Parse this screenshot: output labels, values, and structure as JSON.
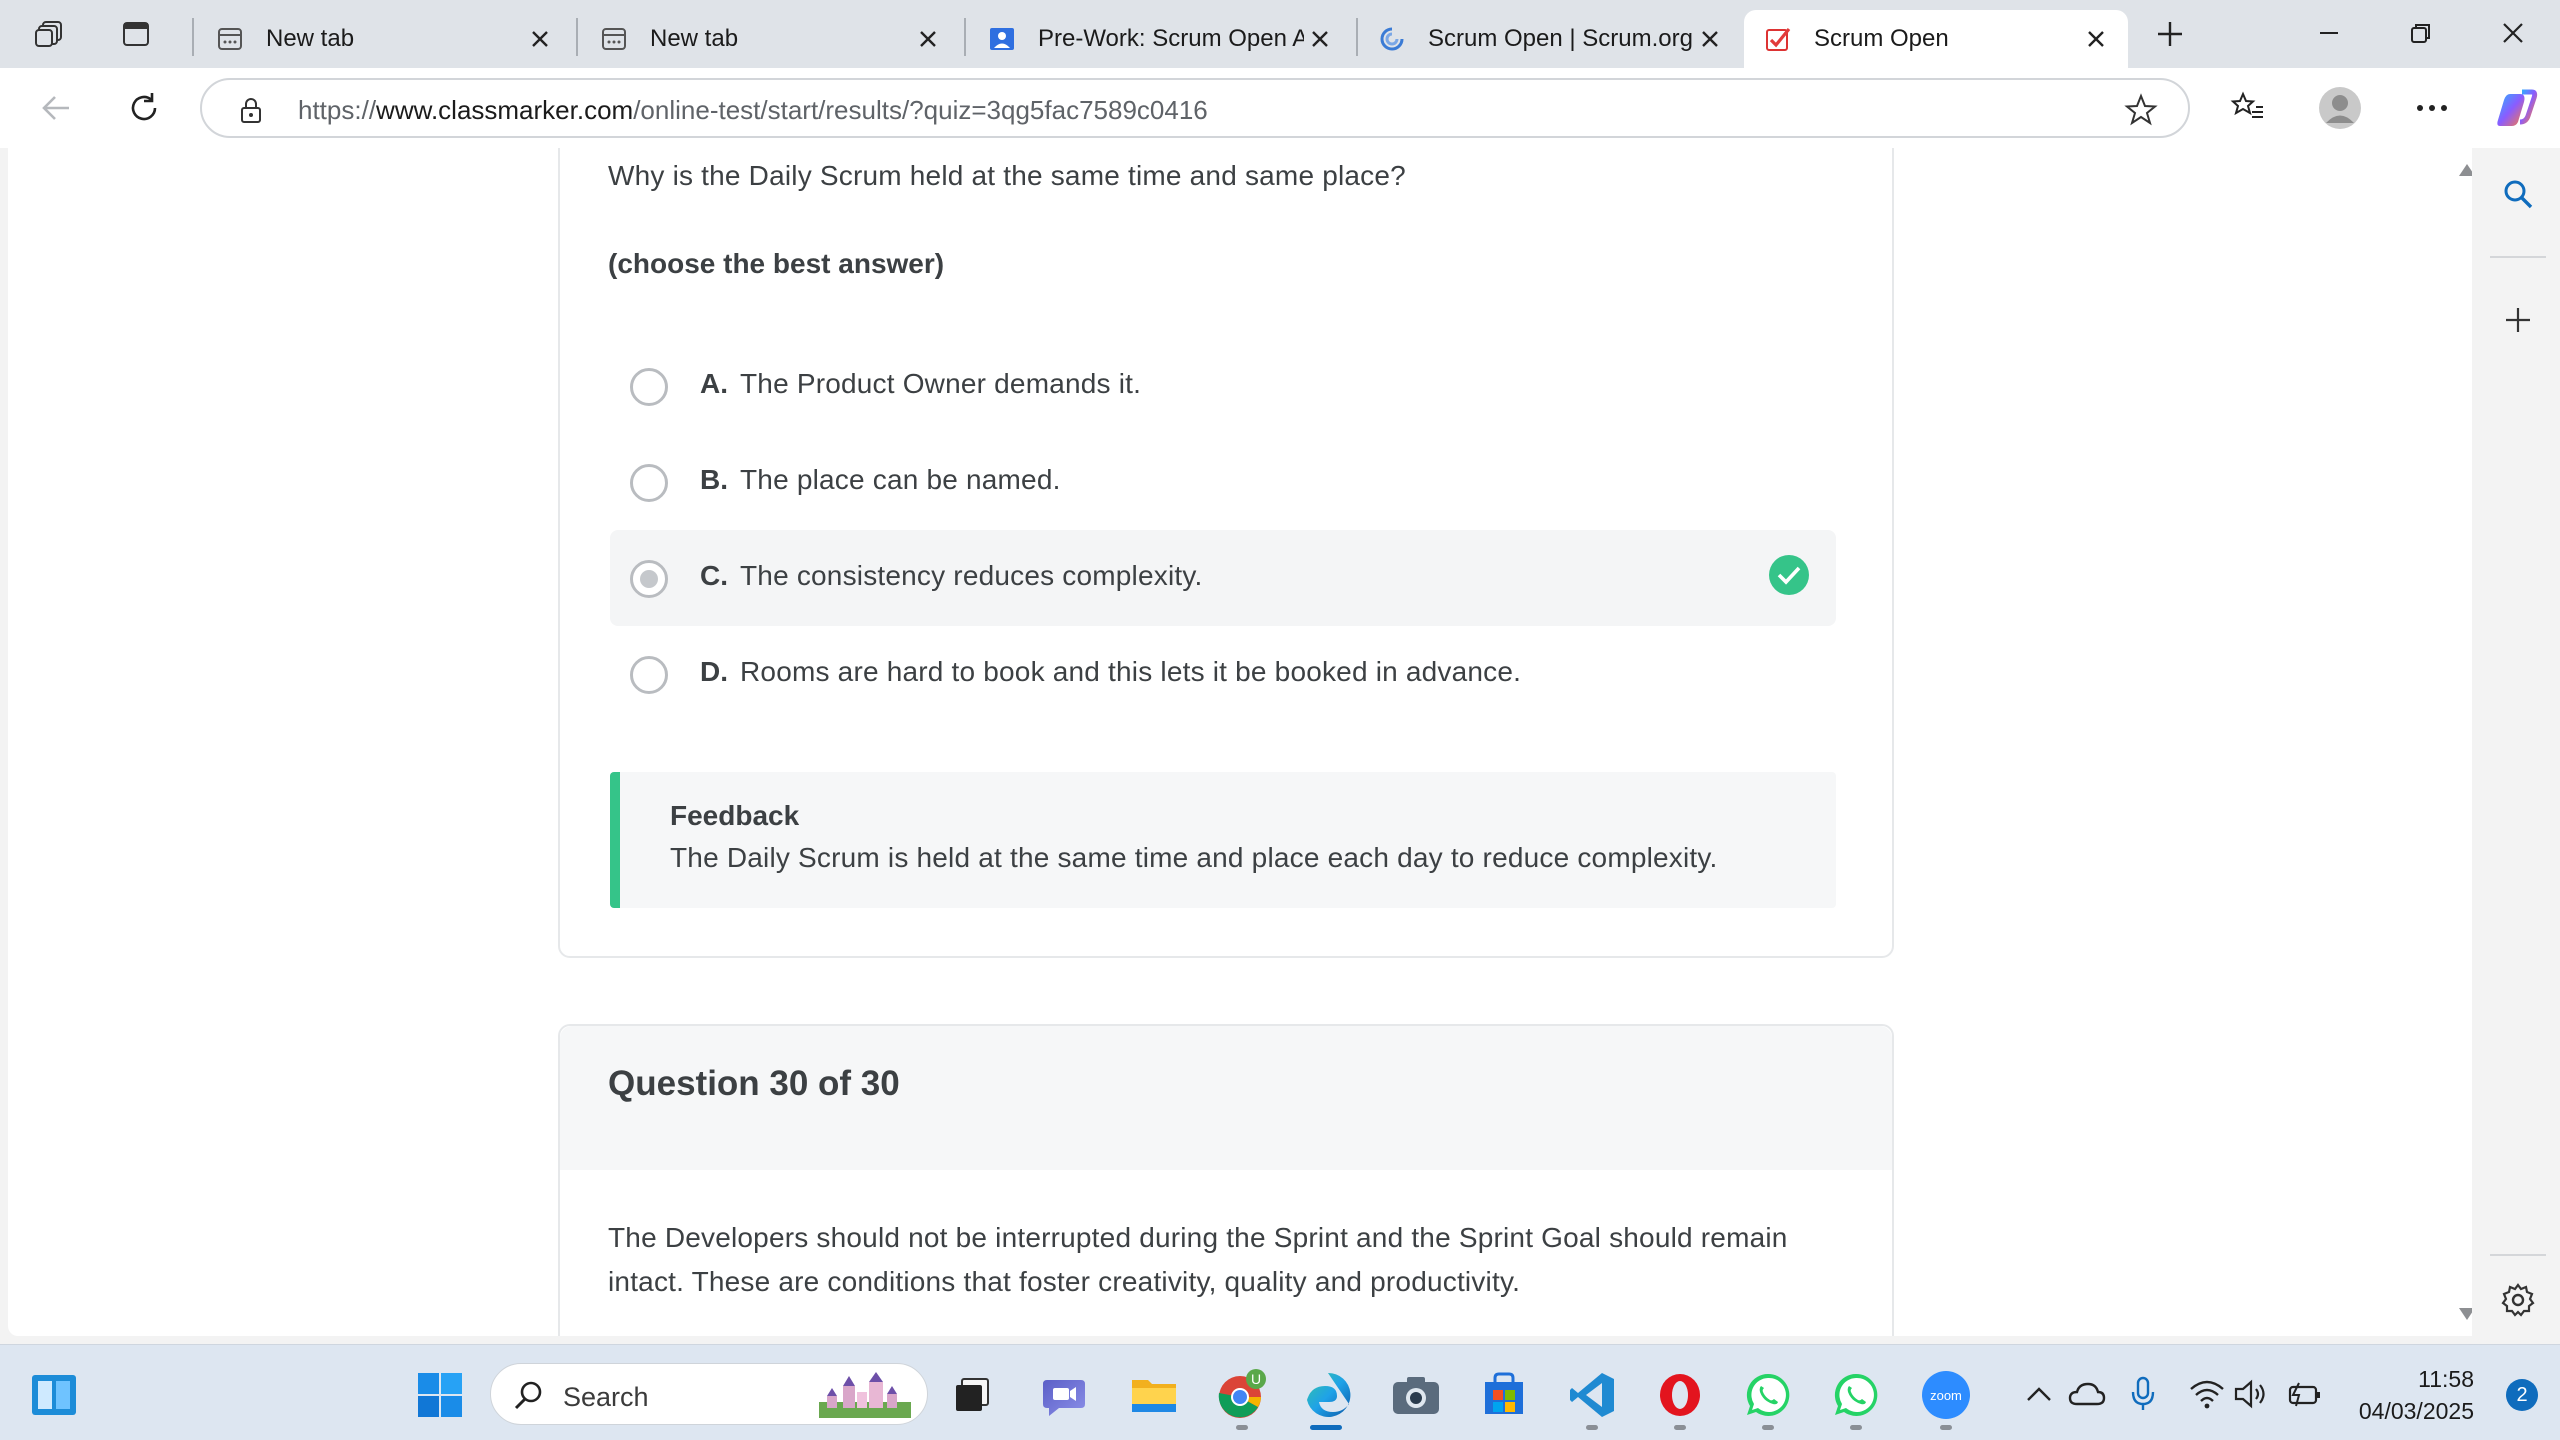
{
  "browser": {
    "tabs": [
      {
        "title": "New tab",
        "active": false
      },
      {
        "title": "New tab",
        "active": false
      },
      {
        "title": "Pre-Work: Scrum Open A",
        "active": false
      },
      {
        "title": "Scrum Open | Scrum.org",
        "active": false
      },
      {
        "title": "Scrum Open",
        "active": true
      }
    ],
    "url_prefix": "https://",
    "url_host": "www.classmarker.com",
    "url_path": "/online-test/start/results/?quiz=3qg5fac7589c0416"
  },
  "question29": {
    "text": "Why is the Daily Scrum held at the same time and same place?",
    "hint": "(choose the best answer)",
    "options": [
      {
        "letter": "A.",
        "text": "The Product Owner demands it.",
        "selected": false,
        "correct": false
      },
      {
        "letter": "B.",
        "text": "The place can be named.",
        "selected": false,
        "correct": false
      },
      {
        "letter": "C.",
        "text": "The consistency reduces complexity.",
        "selected": true,
        "correct": true
      },
      {
        "letter": "D.",
        "text": "Rooms are hard to book and this lets it be booked in advance.",
        "selected": false,
        "correct": false
      }
    ],
    "feedback_title": "Feedback",
    "feedback_text": "The Daily Scrum is held at the same time and place each day to reduce complexity."
  },
  "question30": {
    "title": "Question 30 of 30",
    "text": "The Developers should not be interrupted during the Sprint and the Sprint Goal should remain intact. These are conditions that foster creativity, quality and productivity."
  },
  "taskbar": {
    "search_label": "Search",
    "time": "11:58",
    "date": "04/03/2025",
    "notification_count": "2",
    "chrome_profile_badge": "U",
    "zoom_label": "zoom"
  },
  "colors": {
    "accent_green": "#35c489",
    "edge_blue": "#0f6cbd"
  }
}
